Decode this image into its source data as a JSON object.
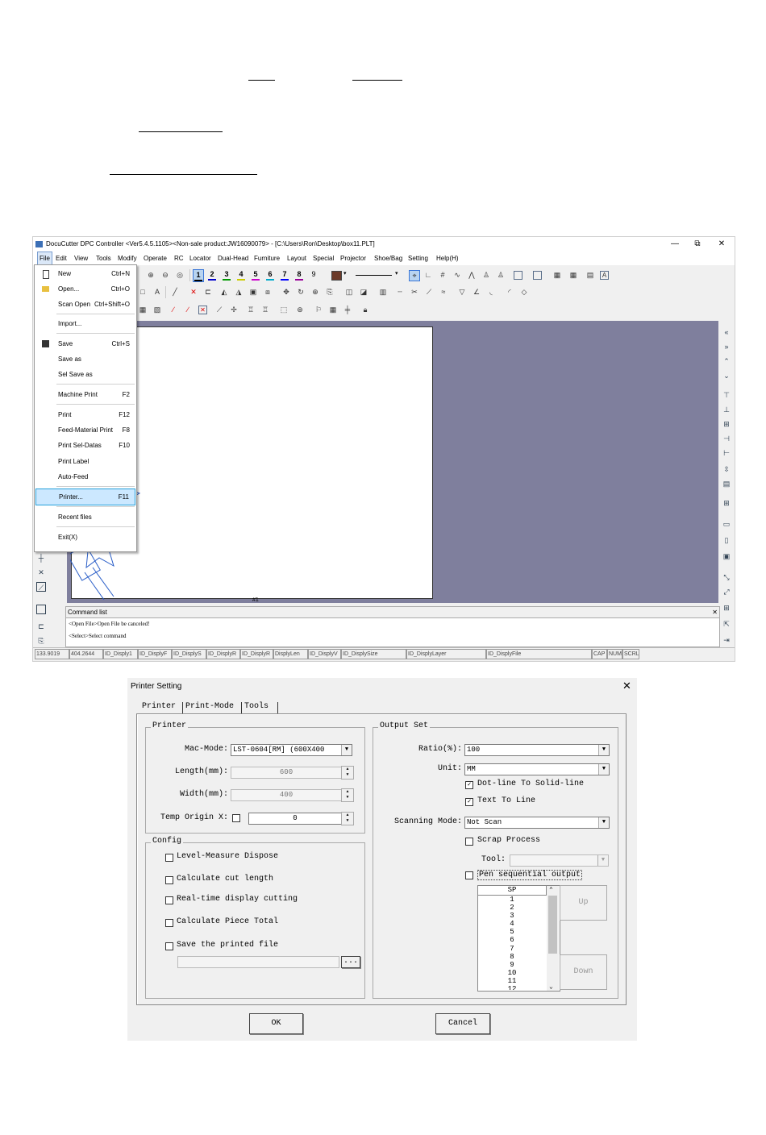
{
  "window": {
    "title": "DocuCutter DPC Controller <Ver5.4.5.1105><Non-sale product:JW16090079> - [C:\\Users\\Ron\\Desktop\\box11.PLT]",
    "minimize": "—",
    "restore": "⧉",
    "close": "✕"
  },
  "menubar": [
    "File",
    "Edit",
    "View",
    "Tools",
    "Modify",
    "Operate",
    "RC",
    "Locator",
    "Dual-Head",
    "Furniture",
    "Layout",
    "Special",
    "Projector",
    "Shoe/Bag",
    "Setting",
    "Help(H)"
  ],
  "file_menu": [
    {
      "label": "New",
      "shortcut": "Ctrl+N",
      "icon": "new-file-icon"
    },
    {
      "label": "Open...",
      "shortcut": "Ctrl+O",
      "icon": "open-folder-icon"
    },
    {
      "label": "Scan Open",
      "shortcut": "Ctrl+Shift+O"
    },
    {
      "label": "Import...",
      "shortcut": ""
    },
    {
      "label": "Save",
      "shortcut": "Ctrl+S",
      "icon": "save-icon"
    },
    {
      "label": "Save as",
      "shortcut": ""
    },
    {
      "label": "Sel Save as",
      "shortcut": ""
    },
    {
      "label": "Machine Print",
      "shortcut": "F2"
    },
    {
      "label": "Print",
      "shortcut": "F12"
    },
    {
      "label": "Feed-Material Print",
      "shortcut": "F8"
    },
    {
      "label": "Print Sel-Datas",
      "shortcut": "F10"
    },
    {
      "label": "Print Label",
      "shortcut": ""
    },
    {
      "label": "Auto-Feed",
      "shortcut": ""
    },
    {
      "label": "Printer...",
      "shortcut": "F11"
    },
    {
      "label": "Recent files",
      "shortcut": ""
    },
    {
      "label": "Exit(X)",
      "shortcut": ""
    }
  ],
  "layers": [
    "1",
    "2",
    "3",
    "4",
    "5",
    "6",
    "7",
    "8",
    "9"
  ],
  "layer_colors": [
    "#000000",
    "#0000cc",
    "#009900",
    "#cccc00",
    "#cc00cc",
    "#00aacc",
    "#0000ff",
    "#990099",
    "#000000"
  ],
  "color_swatch": "#6b3a2a",
  "page_label": "#1",
  "command_panel": {
    "header": "Command list",
    "lines": [
      "<Open File>Open File be canceled!",
      "<Select>Select command"
    ],
    "close": "✕"
  },
  "statusbar": [
    "133.9019",
    "404.2644",
    "ID_Disply1",
    "ID_DisplyF",
    "ID_DisplyS",
    "ID_DisplyR",
    "ID_DisplyR",
    "DisplyLen",
    "ID_DisplyV",
    "ID_DisplySize",
    "ID_DisplyLayer",
    "ID_DisplyFile",
    "CAP",
    "NUM",
    "SCRL"
  ],
  "dialog": {
    "title": "Printer Setting",
    "close": "✕",
    "tabs": [
      "Printer",
      "Print-Mode",
      "Tools"
    ],
    "printer_group": {
      "title": "Printer",
      "mac_mode_label": "Mac-Mode:",
      "mac_mode_value": "LST-0604[RM] (600X400",
      "length_label": "Length(mm):",
      "length_value": "600",
      "width_label": "Width(mm):",
      "width_value": "400",
      "temp_origin_label": "Temp Origin X:",
      "temp_origin_value": "0"
    },
    "config_group": {
      "title": "Config",
      "checks": [
        "Level-Measure Dispose",
        "Calculate cut length",
        "Real-time display cutting",
        "Calculate Piece Total",
        "Save the printed file"
      ],
      "browse": "..."
    },
    "output_group": {
      "title": "Output Set",
      "ratio_label": "Ratio(%):",
      "ratio_value": "100",
      "unit_label": "Unit:",
      "unit_value": "MM",
      "dotline_label": "Dot-line To Solid-line",
      "dotline_checked": "✓",
      "text_to_line_label": "Text To Line",
      "text_to_line_checked": "✓",
      "scanning_mode_label": "Scanning Mode:",
      "scanning_mode_value": "Not Scan",
      "scrap_process_label": "Scrap Process",
      "tool_label": "Tool:",
      "pen_sequential_label": "Pen sequential output",
      "list_header": "SP",
      "list_items": [
        "1",
        "2",
        "3",
        "4",
        "5",
        "6",
        "7",
        "8",
        "9",
        "10",
        "11",
        "12"
      ],
      "up_button": "Up",
      "down_button": "Down"
    },
    "ok_button": "OK",
    "cancel_button": "Cancel"
  }
}
